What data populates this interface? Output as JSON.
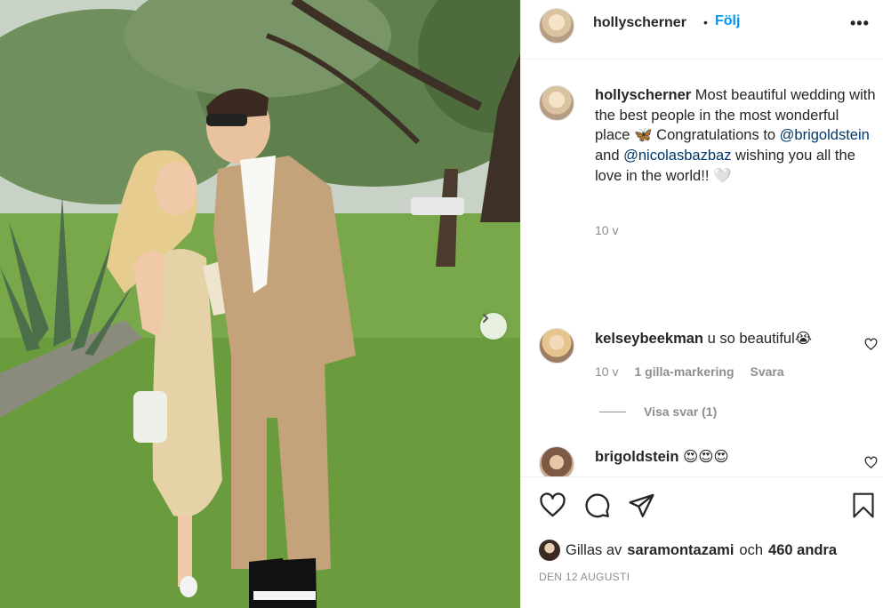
{
  "post": {
    "username": "hollyscherner",
    "follow_label": "Följ",
    "separator": "•",
    "more_label": "•••"
  },
  "caption": {
    "username": "hollyscherner",
    "text_1": " Most beautiful wedding with the best people in the most wonderful place 🦋 Congratulations to ",
    "mention_1": "@brigoldstein",
    "text_2": " and ",
    "mention_2": "@nicolasbazbaz",
    "text_3": " wishing you all the love in the world!! 🤍",
    "time": "10 v"
  },
  "comments": [
    {
      "username": "kelseybeekman",
      "text": " u so beautiful😭",
      "time": "10 v",
      "likes": "1 gilla-markering",
      "reply": "Svara",
      "view_replies": "Visa svar (1)"
    },
    {
      "username": "brigoldstein",
      "text": " 😍😍😍"
    }
  ],
  "likes": {
    "prefix": "Gillas av",
    "user": "saramontazami",
    "and": "och",
    "others": "460 andra"
  },
  "date": "DEN 12 AUGUSTI",
  "icons": {
    "like": "heart-icon",
    "comment": "comment-icon",
    "share": "paper-plane-icon",
    "save": "bookmark-icon",
    "next": "chevron-right-icon",
    "more": "more-icon"
  },
  "colors": {
    "link": "#0095f6",
    "mention": "#00376b",
    "muted": "#8e8e8e",
    "text": "#262626"
  }
}
